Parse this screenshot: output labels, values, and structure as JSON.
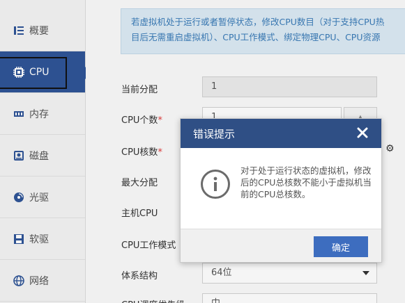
{
  "sidebar": {
    "items": [
      {
        "label": "概要",
        "icon": "overview-icon"
      },
      {
        "label": "CPU",
        "icon": "cpu-icon"
      },
      {
        "label": "内存",
        "icon": "memory-icon"
      },
      {
        "label": "磁盘",
        "icon": "disk-icon"
      },
      {
        "label": "光驱",
        "icon": "cdrom-icon"
      },
      {
        "label": "软驱",
        "icon": "floppy-icon"
      },
      {
        "label": "网络",
        "icon": "network-icon"
      }
    ],
    "active": "CPU"
  },
  "info_banner": {
    "line1": "若虚拟机处于运行或者暂停状态，修改CPU数目（对于支持CPU热",
    "line2": "目后无需重启虚拟机）、CPU工作模式、绑定物理CPU、CPU资源"
  },
  "form": {
    "current_alloc_label": "当前分配",
    "current_alloc_value": "1",
    "cpu_count_label": "CPU个数",
    "cpu_count_value": "1",
    "cpu_cores_label": "CPU核数",
    "max_alloc_label": "最大分配",
    "host_cpu_label": "主机CPU",
    "cpu_mode_label": "CPU工作模式",
    "arch_label": "体系结构",
    "arch_value": "64位",
    "cpu_priority_label": "CPU调度优先级",
    "cpu_priority_value": "中",
    "required_mark": "*"
  },
  "modal": {
    "title": "错误提示",
    "message": "对于处于运行状态的虚拟机，修改后的CPU总核数不能小于虚拟机当前的CPU总核数。",
    "ok_label": "确定"
  },
  "colors": {
    "accent": "#2f5597",
    "modal_header": "#2f4f85",
    "button": "#3d6dbf",
    "banner_bg": "#dcebf5",
    "banner_text": "#3a7bb8",
    "required": "#e03a3a"
  }
}
